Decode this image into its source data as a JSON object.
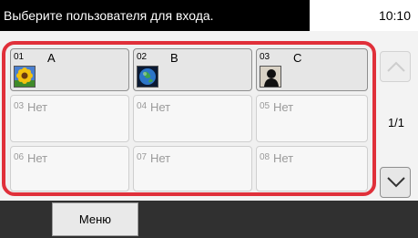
{
  "header": {
    "title": "Выберите пользователя для входа.",
    "time": "10:10"
  },
  "users": [
    {
      "num": "01",
      "name": "A",
      "icon": "sunflower-icon"
    },
    {
      "num": "02",
      "name": "B",
      "icon": "earth-icon"
    },
    {
      "num": "03",
      "name": "C",
      "icon": "silhouette-icon"
    },
    {
      "num": "03",
      "name": "Нет"
    },
    {
      "num": "04",
      "name": "Нет"
    },
    {
      "num": "05",
      "name": "Нет"
    },
    {
      "num": "06",
      "name": "Нет"
    },
    {
      "num": "07",
      "name": "Нет"
    },
    {
      "num": "08",
      "name": "Нет"
    }
  ],
  "pager": {
    "indicator": "1/1"
  },
  "footer": {
    "menu_label": "Меню"
  },
  "colors": {
    "highlight_border": "#e0303a",
    "title_bg": "#000000",
    "bottom_bg": "#303030"
  }
}
